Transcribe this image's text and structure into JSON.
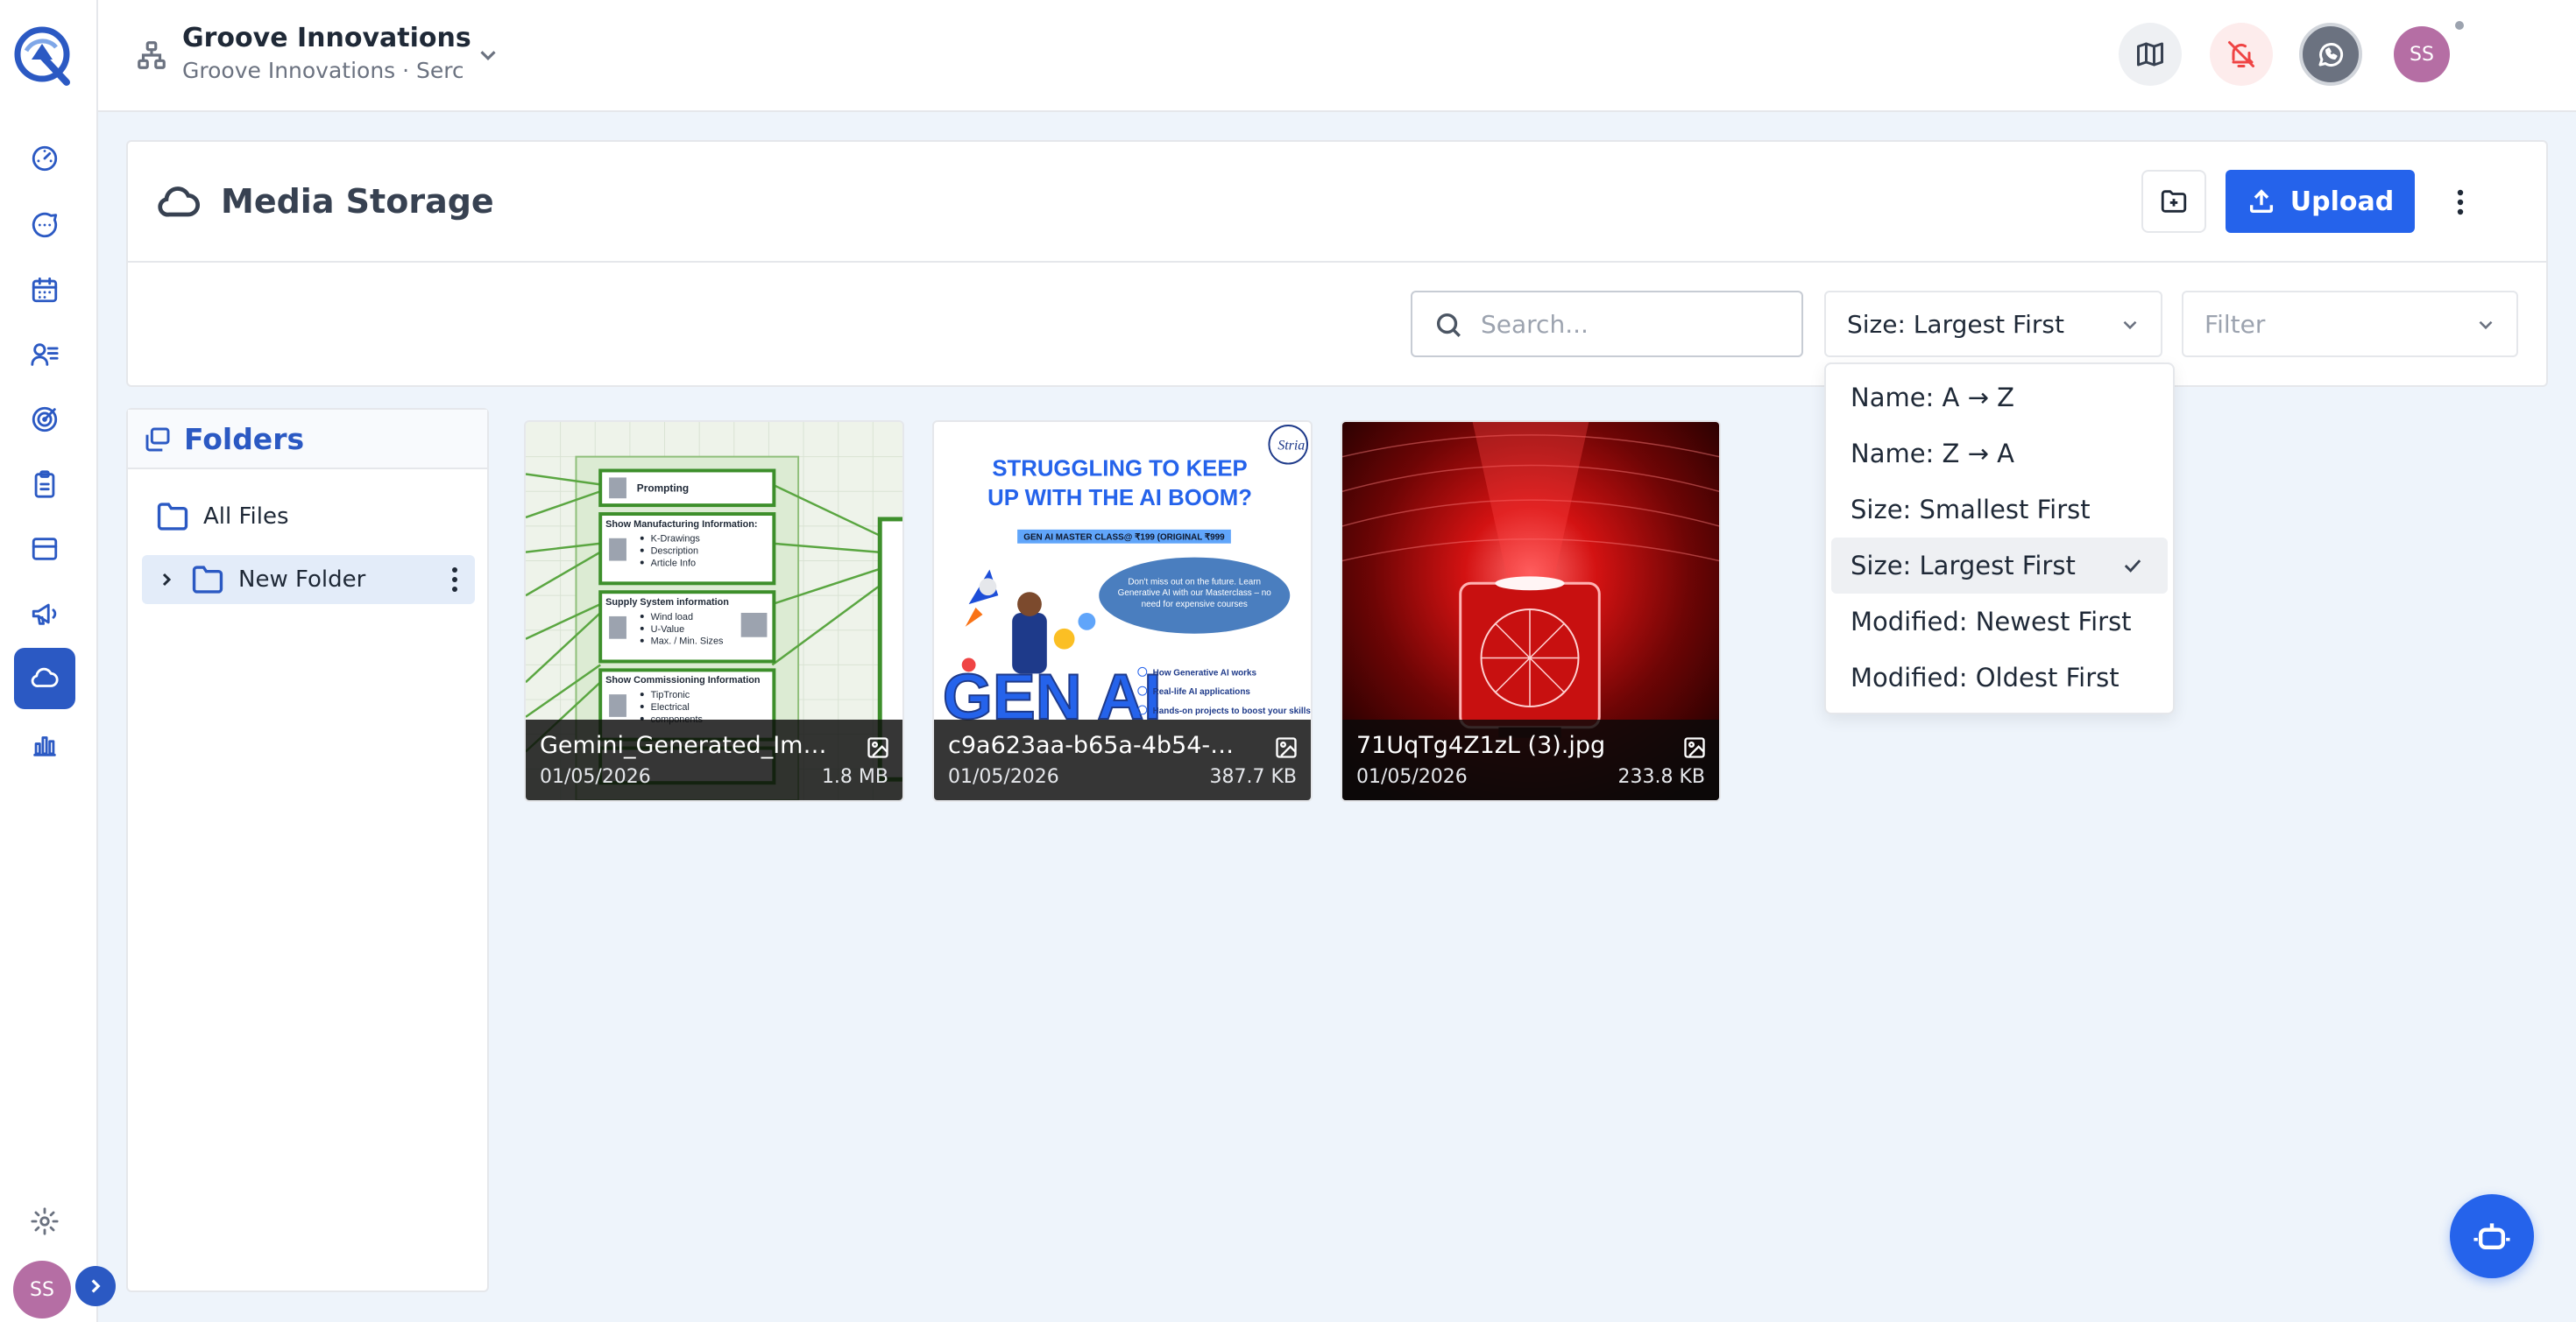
{
  "app": {
    "org_name": "Groove Innovations",
    "org_sub": "Groove Innovations · Serc...",
    "user_initials": "SS"
  },
  "nav": {
    "items": [
      {
        "icon": "dashboard-icon"
      },
      {
        "icon": "chat-icon"
      },
      {
        "icon": "calendar-icon"
      },
      {
        "icon": "contacts-icon"
      },
      {
        "icon": "target-icon"
      },
      {
        "icon": "clipboard-icon"
      },
      {
        "icon": "inbox-icon"
      },
      {
        "icon": "megaphone-icon"
      },
      {
        "icon": "cloud-icon",
        "active": true
      },
      {
        "icon": "bar-chart-icon"
      }
    ],
    "settings_icon": "gear-icon",
    "expand_icon": "chevron-right-icon"
  },
  "page": {
    "title": "Media Storage",
    "upload_label": "Upload",
    "search_placeholder": "Search...",
    "sort_value": "Size: Largest First",
    "filter_placeholder": "Filter"
  },
  "sort_options": [
    {
      "label": "Name: A → Z",
      "selected": false
    },
    {
      "label": "Name: Z → A",
      "selected": false
    },
    {
      "label": "Size: Smallest First",
      "selected": false
    },
    {
      "label": "Size: Largest First",
      "selected": true
    },
    {
      "label": "Modified: Newest First",
      "selected": false
    },
    {
      "label": "Modified: Oldest First",
      "selected": false
    }
  ],
  "folders": {
    "title": "Folders",
    "items": [
      {
        "label": "All Files"
      },
      {
        "label": "New Folder",
        "selected": true
      }
    ]
  },
  "files": [
    {
      "name": "Gemini_Generated_Ima...",
      "date": "01/05/2026",
      "size": "1.8 MB"
    },
    {
      "name": "c9a623aa-b65a-4b54-8...",
      "date": "01/05/2026",
      "size": "387.7 KB"
    },
    {
      "name": "71UqTg4Z1zL (3).jpg",
      "date": "01/05/2026",
      "size": "233.8 KB"
    }
  ],
  "thumb2": {
    "headline_1": "STRUGGLING TO KEEP",
    "headline_2": "UP WITH THE AI BOOM?",
    "badge": "GEN AI MASTER CLASS@ ₹199 (ORIGINAL ₹999",
    "bubble": "Don't miss out on the future. Learn Generative AI with our Masterclass – no need for expensive courses",
    "logo": "Stria",
    "genai_text": "GEN AI",
    "bullets": [
      "How Generative AI works",
      "Real-life AI applications",
      "Hands-on projects to boost your skills"
    ]
  },
  "thumb1": {
    "boxes": [
      {
        "title": "Prompting",
        "lines": []
      },
      {
        "title": "Show Manufacturing Information:",
        "lines": [
          "K-Drawings",
          "Description",
          "Article Info"
        ]
      },
      {
        "title": "Supply System information",
        "lines": [
          "Wind load",
          "U-Value",
          "Max. / Min. Sizes"
        ]
      },
      {
        "title": "Show Commissioning Information",
        "lines": [
          "TipTronic",
          "Electrical",
          "components"
        ]
      }
    ]
  }
}
